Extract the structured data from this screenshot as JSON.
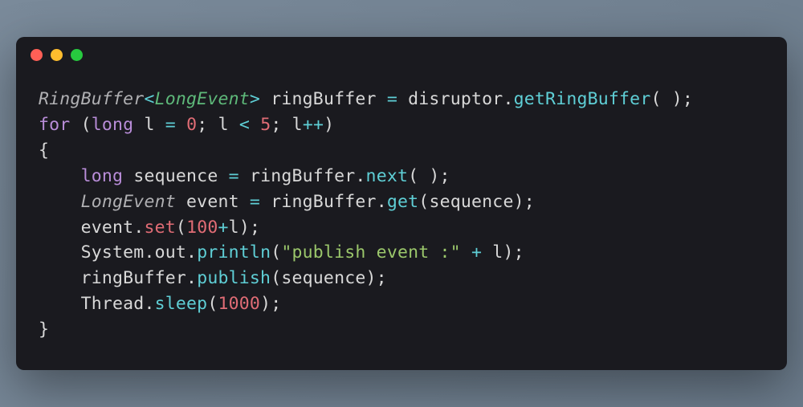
{
  "titlebar": {
    "controls": [
      "close",
      "minimize",
      "zoom"
    ]
  },
  "code": {
    "line1": {
      "t_RingBuffer": "RingBuffer",
      "t_lt": "<",
      "t_LongEvent": "LongEvent",
      "t_gt": ">",
      "sp1": " ",
      "v_ringBuffer": "ringBuffer",
      "sp2": " ",
      "op_eq": "=",
      "sp3": " ",
      "v_disruptor": "disruptor",
      "dot": ".",
      "m_getRingBuffer": "getRingBuffer",
      "paren": "( );"
    },
    "line2": {
      "kw_for": "for",
      "sp1": " ",
      "lparen": "(",
      "kw_long": "long",
      "sp2": " ",
      "v_l": "l",
      "sp3": " ",
      "op_eq": "=",
      "sp4": " ",
      "n_0": "0",
      "semi1": ";",
      "sp5": " ",
      "v_l2": "l",
      "sp6": " ",
      "op_lt": "<",
      "sp7": " ",
      "n_5": "5",
      "semi2": ";",
      "sp8": " ",
      "v_l3": "l",
      "op_inc": "++",
      "rparen": ")"
    },
    "line3": {
      "brace": "{"
    },
    "line4": {
      "indent": "    ",
      "kw_long": "long",
      "sp1": " ",
      "v_sequence": "sequence",
      "sp2": " ",
      "op_eq": "=",
      "sp3": " ",
      "v_ringBuffer": "ringBuffer",
      "dot": ".",
      "m_next": "next",
      "paren": "( );"
    },
    "line5": {
      "indent": "    ",
      "t_LongEvent": "LongEvent",
      "sp1": " ",
      "v_event": "event",
      "sp2": " ",
      "op_eq": "=",
      "sp3": " ",
      "v_ringBuffer": "ringBuffer",
      "dot": ".",
      "m_get": "get",
      "lparen": "(",
      "v_sequence": "sequence",
      "rparen": ");"
    },
    "line6": {
      "indent": "    ",
      "v_event": "event",
      "dot": ".",
      "m_set": "set",
      "lparen": "(",
      "n_100": "100",
      "op_plus": "+",
      "v_l": "l",
      "rparen": ");"
    },
    "line7": {
      "indent": "    ",
      "v_System": "System",
      "dot1": ".",
      "v_out": "out",
      "dot2": ".",
      "m_println": "println",
      "lparen": "(",
      "str": "\"publish event :\"",
      "sp1": " ",
      "op_plus": "+",
      "sp2": " ",
      "v_l": "l",
      "rparen": ");"
    },
    "line8": {
      "indent": "    ",
      "v_ringBuffer": "ringBuffer",
      "dot": ".",
      "m_publish": "publish",
      "lparen": "(",
      "v_sequence": "sequence",
      "rparen": ");"
    },
    "line9": {
      "indent": "    ",
      "v_Thread": "Thread",
      "dot": ".",
      "m_sleep": "sleep",
      "lparen": "(",
      "n_1000": "1000",
      "rparen": ");"
    },
    "line10": {
      "brace": "}"
    }
  }
}
